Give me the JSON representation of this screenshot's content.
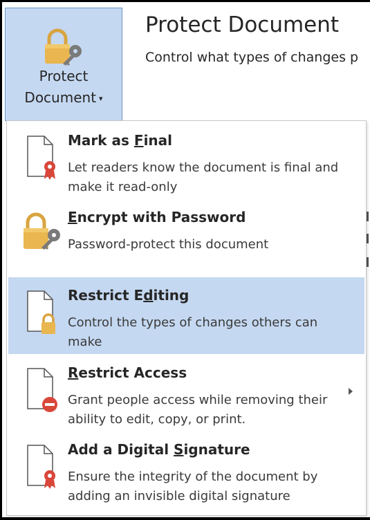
{
  "ribbon": {
    "button_label_line1": "Protect",
    "button_label_line2": "Document",
    "caret": "▾",
    "button_icon": "lock-key-icon"
  },
  "header": {
    "title": "Protect Document",
    "subtitle": "Control what types of changes p"
  },
  "menu": {
    "items": [
      {
        "title_pre": "Mark as ",
        "title_u": "F",
        "title_post": "inal",
        "description": "Let readers know the document is final and make it read-only",
        "icon": "document-ribbon-icon",
        "active": false
      },
      {
        "title_pre": "",
        "title_u": "E",
        "title_post": "ncrypt with Password",
        "description": "Password-protect this document",
        "icon": "lock-key-icon",
        "active": false
      },
      {
        "title_pre": "Restrict E",
        "title_u": "d",
        "title_post": "iting",
        "description": "Control the types of changes others can make",
        "icon": "document-lock-icon",
        "active": true
      },
      {
        "title_pre": "",
        "title_u": "R",
        "title_post": "estrict Access",
        "description": "Grant people access while removing their ability to edit, copy, or print.",
        "icon": "document-no-entry-icon",
        "active": false,
        "has_submenu": true
      },
      {
        "title_pre": "Add a Digital ",
        "title_u": "S",
        "title_post": "ignature",
        "description": "Ensure the integrity of the document by adding an invisible digital signature",
        "icon": "document-ribbon-icon",
        "active": false
      }
    ]
  },
  "colors": {
    "highlight": "#c5d8f1",
    "highlight_border": "#6b95c9",
    "lock_gold": "#e9b64f",
    "key_gray": "#7a7a7a",
    "ribbon_red": "#d9473a"
  }
}
